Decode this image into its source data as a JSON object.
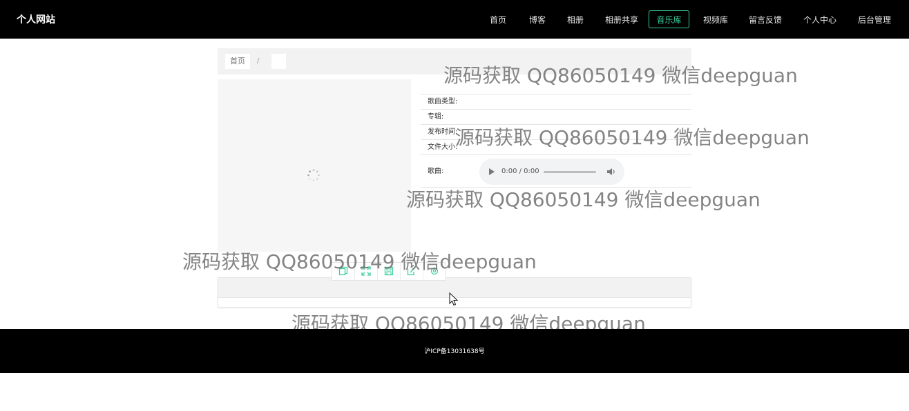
{
  "site": {
    "brand": "个人网站"
  },
  "nav": {
    "items": [
      {
        "label": "首页"
      },
      {
        "label": "博客"
      },
      {
        "label": "相册"
      },
      {
        "label": "相册共享"
      },
      {
        "label": "音乐库",
        "active": true
      },
      {
        "label": "视频库"
      },
      {
        "label": "留言反馈"
      },
      {
        "label": "个人中心"
      },
      {
        "label": "后台管理"
      }
    ]
  },
  "breadcrumb": {
    "home": "首页",
    "separator": "/"
  },
  "details": {
    "genre_label": "歌曲类型:",
    "album_label": "专辑:",
    "release_label": "发布时间:",
    "size_label": "文件大小:",
    "song_label": "歌曲:"
  },
  "audio": {
    "time": "0:00 / 0:00"
  },
  "toolbar": {
    "icons": [
      "copy-icon",
      "fullscreen-icon",
      "save-icon",
      "edit-icon",
      "settings-icon"
    ]
  },
  "watermark": {
    "text": "源码获取 QQ86050149 微信deepguan"
  },
  "footer": {
    "icp": "沪ICP备13031638号"
  },
  "colors": {
    "accent": "#3ecfa0",
    "nav_bg": "#000000"
  }
}
